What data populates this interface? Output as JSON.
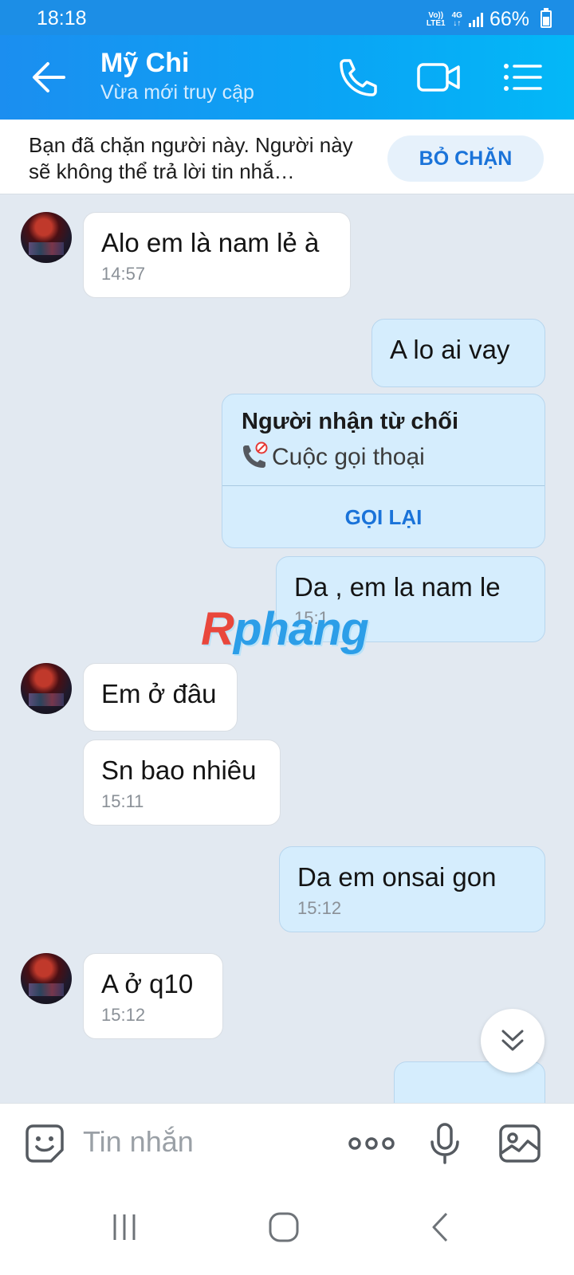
{
  "status_bar": {
    "time": "18:18",
    "network_top": "Vo))",
    "network_bottom": "LTE1",
    "network_type": "4G",
    "battery": "66%"
  },
  "header": {
    "name": "Mỹ Chi",
    "status": "Vừa mới truy cập"
  },
  "block_banner": {
    "text": "Bạn đã chặn người này. Người này sẽ không thể trả lời tin nhắ…",
    "unblock_label": "BỎ CHẶN"
  },
  "messages": [
    {
      "side": "in",
      "text": "Alo em là nam lẻ à",
      "time": "14:57"
    },
    {
      "side": "out",
      "text": "A lo ai vay",
      "time": ""
    },
    {
      "side": "out",
      "type": "call",
      "title": "Người nhận từ chối",
      "call_label": "Cuộc gọi thoại",
      "action": "GỌI LẠI"
    },
    {
      "side": "out",
      "text": "Da , em la nam le",
      "time": "15:1"
    },
    {
      "side": "in",
      "text": "Em ở đâu",
      "time": ""
    },
    {
      "side": "in",
      "text": "Sn bao nhiêu",
      "time": "15:11"
    },
    {
      "side": "out",
      "text": "Da em onsai gon",
      "time": "15:12"
    },
    {
      "side": "in",
      "text": "A ở q10",
      "time": "15:12"
    }
  ],
  "watermark": {
    "first": "R",
    "rest": "phang"
  },
  "composer": {
    "placeholder": "Tin nhắn"
  },
  "colors": {
    "header_start": "#1b8ef0",
    "header_end": "#03b8f7",
    "accent": "#1a73d9",
    "chat_bg": "#e2e9f1",
    "out_bubble": "#d5edfd"
  }
}
